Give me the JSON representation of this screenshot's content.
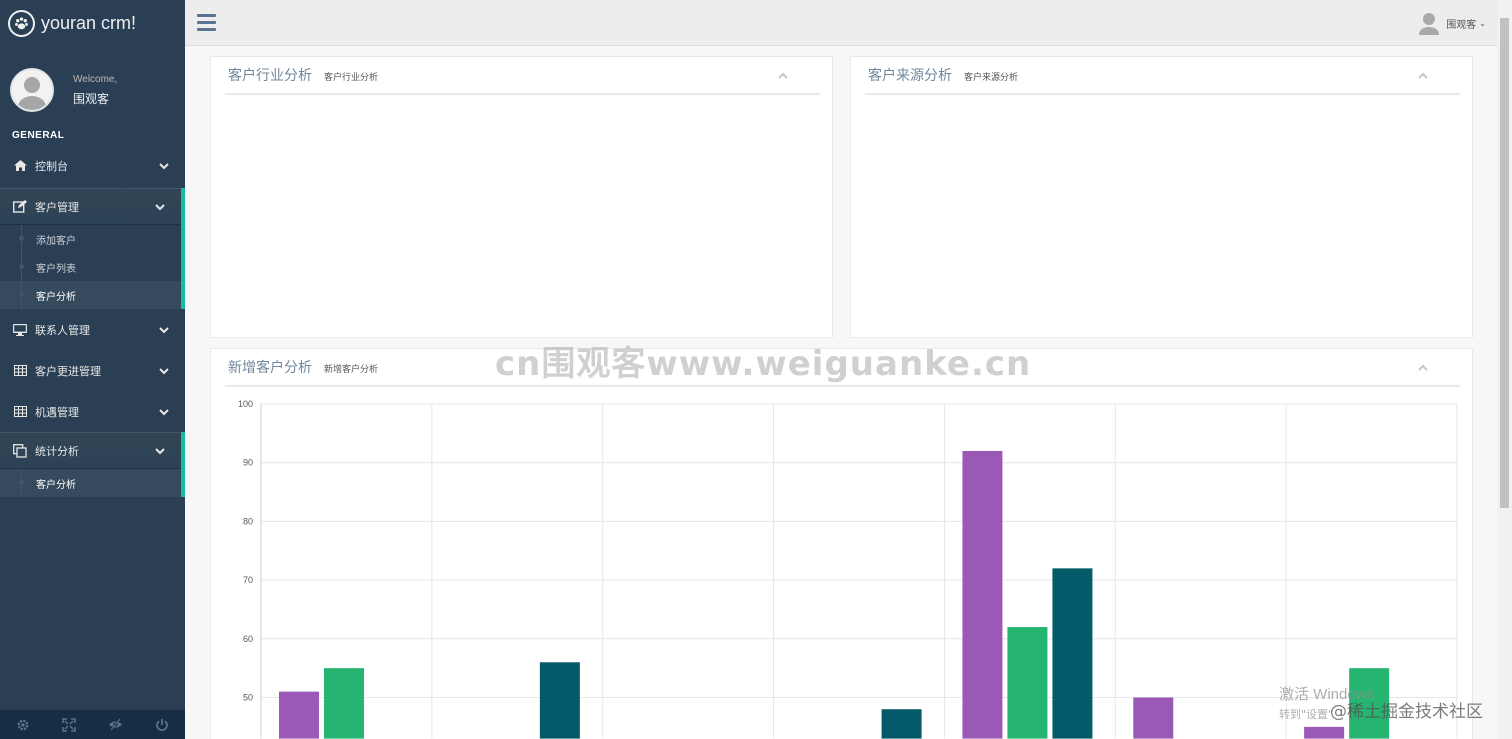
{
  "brand": {
    "name": "youran crm!",
    "logo_icon": "paw-icon"
  },
  "profile": {
    "welcome": "Welcome,",
    "name": "围观客"
  },
  "sidebar": {
    "section_title": "GENERAL",
    "items": [
      {
        "label": "控制台",
        "icon": "home-icon"
      },
      {
        "label": "客户管理",
        "icon": "edit-icon"
      },
      {
        "label": "联系人管理",
        "icon": "desktop-icon"
      },
      {
        "label": "客户更进管理",
        "icon": "table-icon"
      },
      {
        "label": "机遇管理",
        "icon": "table-icon"
      },
      {
        "label": "统计分析",
        "icon": "copy-icon"
      }
    ],
    "customer_submenu": [
      "添加客户",
      "客户列表",
      "客户分析"
    ],
    "stats_submenu": [
      "客户分析"
    ],
    "footer_icons": [
      "settings-icon",
      "fullscreen-icon",
      "eye-slash-icon",
      "power-icon"
    ]
  },
  "topnav": {
    "user_name": "围观客",
    "caret": "⌄"
  },
  "panels": {
    "industry": {
      "title": "客户行业分析",
      "subtitle": "客户行业分析"
    },
    "source": {
      "title": "客户来源分析",
      "subtitle": "客户来源分析"
    },
    "new": {
      "title": "新增客户分析",
      "subtitle": "新增客户分析"
    }
  },
  "overlays": {
    "watermark": "cn围观客www.weiguanke.cn",
    "windows_line1": "激活 Windows",
    "windows_line2": "转到\"设置\"",
    "juejin": "@稀土掘金技术社区"
  },
  "colors": {
    "sidebar": "#2a3f54",
    "accent": "#1abb9c",
    "series_purple": "#9b59b6",
    "series_green": "#26b571",
    "series_teal": "#055a6a"
  },
  "chart_data": {
    "type": "bar",
    "y_ticks": [
      50,
      60,
      70,
      80,
      90,
      100
    ],
    "ylim": [
      43,
      100
    ],
    "grid": true,
    "groups": 7,
    "series": [
      {
        "values": [
          51,
          null,
          null,
          null,
          92,
          50,
          45
        ],
        "color": "#9b59b6"
      },
      {
        "values": [
          55,
          null,
          null,
          null,
          62,
          null,
          55
        ],
        "color": "#26b571"
      },
      {
        "values": [
          null,
          56,
          null,
          48,
          72,
          null,
          null
        ],
        "color": "#055a6a"
      }
    ]
  }
}
